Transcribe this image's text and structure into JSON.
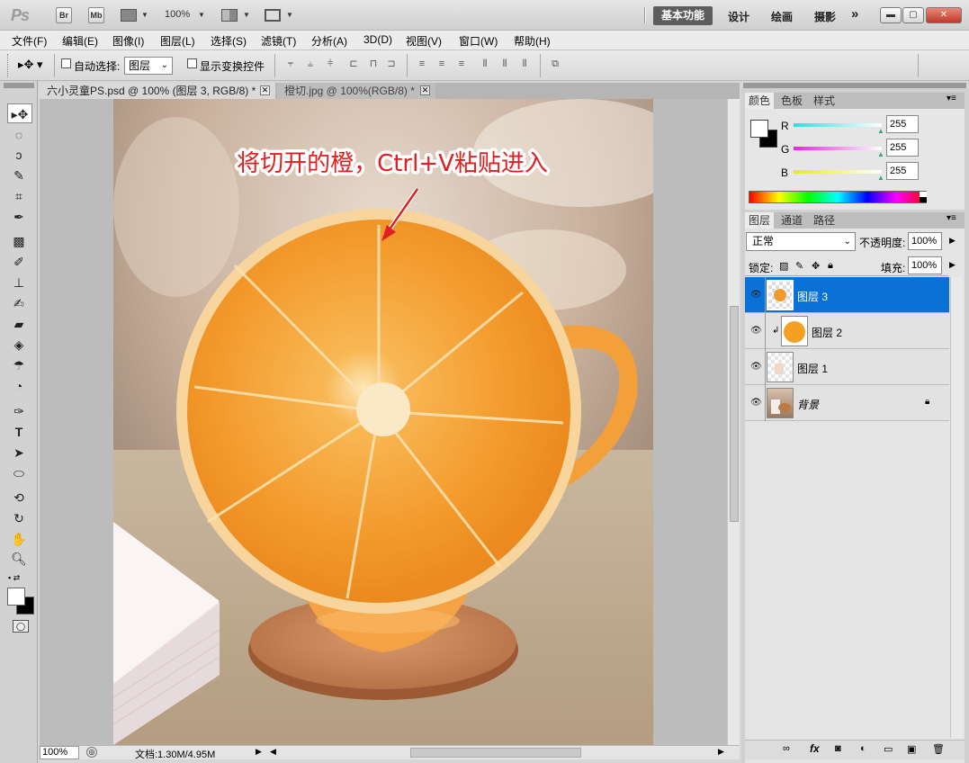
{
  "app": {
    "logo": "Ps",
    "bridge_btn": "Br",
    "minibridge_btn": "Mb",
    "zoom": "100%",
    "workspaces": [
      "基本功能",
      "设计",
      "绘画",
      "摄影"
    ],
    "more": "»"
  },
  "menu": [
    "文件(F)",
    "编辑(E)",
    "图像(I)",
    "图层(L)",
    "选择(S)",
    "滤镜(T)",
    "分析(A)",
    "3D(D)",
    "视图(V)",
    "窗口(W)",
    "帮助(H)"
  ],
  "options": {
    "auto_select_label": "自动选择:",
    "auto_select_value": "图层",
    "show_transform_label": "显示变换控件"
  },
  "tabs": [
    {
      "label": "六小灵童PS.psd @ 100% (图层 3, RGB/8) *",
      "active": true
    },
    {
      "label": "橙切.jpg @ 100%(RGB/8) *",
      "active": false
    }
  ],
  "canvas": {
    "annotation": "将切开的橙，Ctrl+V粘贴进入"
  },
  "status": {
    "zoom": "100%",
    "doc": "文档:1.30M/4.95M"
  },
  "color_panel": {
    "tabs": [
      "颜色",
      "色板",
      "样式"
    ],
    "channels": [
      {
        "name": "R",
        "value": "255",
        "color": "#28e0e0"
      },
      {
        "name": "G",
        "value": "255",
        "color": "#e028d8"
      },
      {
        "name": "B",
        "value": "255",
        "color": "#e8e828"
      }
    ]
  },
  "layers_panel": {
    "tabs": [
      "图层",
      "通道",
      "路径"
    ],
    "blend_mode": "正常",
    "opacity_label": "不透明度:",
    "opacity": "100%",
    "lock_label": "锁定:",
    "fill_label": "填充:",
    "fill": "100%",
    "layers": [
      {
        "name": "图层 3",
        "selected": true
      },
      {
        "name": "图层 2",
        "selected": false
      },
      {
        "name": "图层 1",
        "selected": false
      },
      {
        "name": "背景",
        "selected": false
      }
    ]
  },
  "colors": {
    "selection": "#0a72d6",
    "annotation_text": "#e02020",
    "orange": "#f59a2a"
  }
}
